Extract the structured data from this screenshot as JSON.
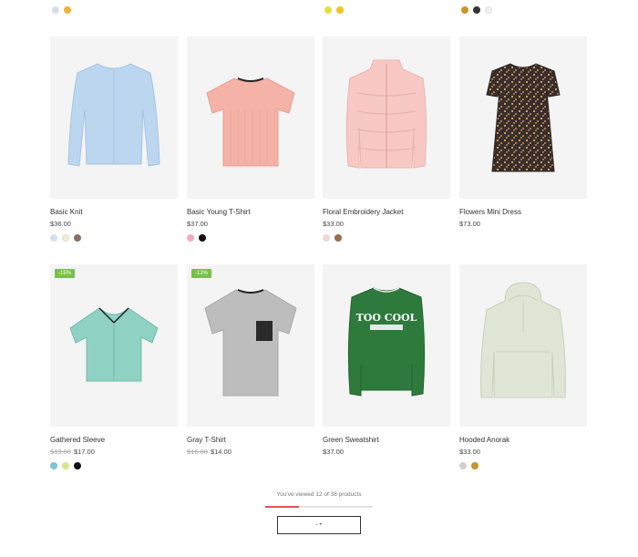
{
  "top_partial_row": [
    {
      "swatches": [
        "#cfe0f3",
        "#f2b23a"
      ]
    },
    {
      "swatches": []
    },
    {
      "swatches": [
        "#e6e03d",
        "#f0c324"
      ]
    },
    {
      "swatches": [
        "#c8952c",
        "#333333",
        "#f2f2f2"
      ]
    }
  ],
  "products": [
    {
      "name": "Basic Knit",
      "price": "$36.00",
      "old_price": "",
      "badge": "",
      "swatches": [
        "#cfe0f3",
        "#f7efc8",
        "#8a6f63"
      ],
      "icon": "cardigan-icon",
      "color": "#bcd6f0"
    },
    {
      "name": "Basic Young T-Shirt",
      "price": "$37.00",
      "old_price": "",
      "badge": "",
      "swatches": [
        "#f5a8c6",
        "#111111"
      ],
      "icon": "tshirt-icon",
      "color": "#f5b3a7"
    },
    {
      "name": "Floral Embroidery Jacket",
      "price": "$33.00",
      "old_price": "",
      "badge": "",
      "swatches": [
        "#f7d2cb",
        "#9a6d4c"
      ],
      "icon": "puffer-jacket-icon",
      "color": "#f8c9c4"
    },
    {
      "name": "Flowers Mini Dress",
      "price": "$73.00",
      "old_price": "",
      "badge": "",
      "swatches": [],
      "icon": "dress-icon",
      "color": "#3a2e2a"
    },
    {
      "name": "Gathered Sleeve",
      "price": "$17.00",
      "old_price": "$19.00",
      "badge": "-15%",
      "swatches": [
        "#7cc3d0",
        "#d8e58f",
        "#111111"
      ],
      "icon": "crop-top-icon",
      "color": "#8fd1c2"
    },
    {
      "name": "Gray T-Shirt",
      "price": "$14.00",
      "old_price": "$16.00",
      "badge": "-12%",
      "swatches": [],
      "icon": "pocket-tshirt-icon",
      "color": "#bdbdbd"
    },
    {
      "name": "Green Sweatshirt",
      "price": "$37.00",
      "old_price": "",
      "badge": "",
      "swatches": [],
      "icon": "sweatshirt-icon",
      "color": "#2e7a3d"
    },
    {
      "name": "Hooded Anorak",
      "price": "$33.00",
      "old_price": "",
      "badge": "",
      "swatches": [
        "#cfcfcf",
        "#c4952a"
      ],
      "icon": "anorak-icon",
      "color": "#dfe6d6"
    }
  ],
  "sweatshirt_print": "TOO COOL",
  "footer": {
    "viewed_text": "You've viewed 12 of 38 products",
    "progress_fraction": 0.3158,
    "load_more_label": "- +"
  },
  "colors": {
    "badge": "#7ac143",
    "progress_fill": "#e8505b",
    "card_bg": "#f4f4f4"
  }
}
